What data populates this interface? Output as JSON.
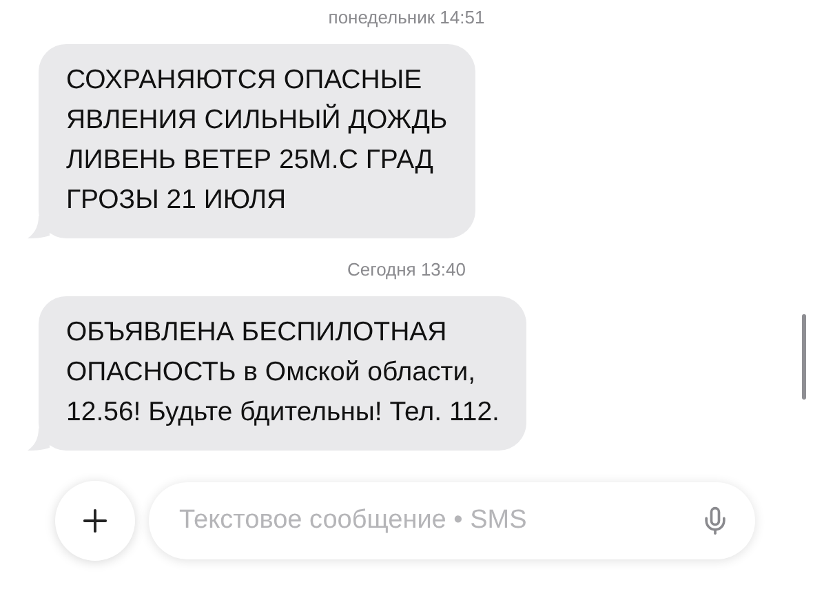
{
  "messages": [
    {
      "time": "понедельник 14:51",
      "text": "СОХРАНЯЮТСЯ ОПАСНЫЕ\nЯВЛЕНИЯ СИЛЬНЫЙ ДОЖДЬ\nЛИВЕНЬ ВЕТЕР 25М.С ГРАД\nГРОЗЫ 21 ИЮЛЯ"
    },
    {
      "time": "Сегодня 13:40",
      "text": "ОБЪЯВЛЕНА БЕСПИЛОТНАЯ\nОПАСНОСТЬ в Омской области,\n12.56! Будьте бдительны! Тел. 112."
    }
  ],
  "composer": {
    "placeholder": "Текстовое сообщение • SMS"
  }
}
